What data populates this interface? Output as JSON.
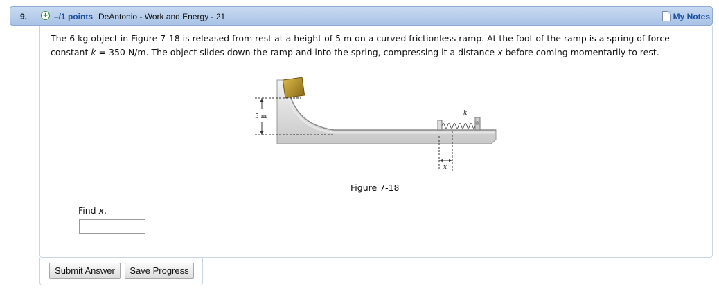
{
  "question": {
    "number": "9.",
    "points": "–/1 points",
    "title": "DeAntonio - Work and Energy - 21",
    "my_notes": "My Notes"
  },
  "problem": {
    "text_1": "The 6 kg object in Figure 7-18 is released from rest at a height of 5 m on a curved frictionless ramp. At the foot of the ramp is a spring of force constant ",
    "k_var": "k",
    "text_2": " = 350 N/m. The object slides down the ramp and into the spring, compressing it a distance ",
    "x_var": "x",
    "text_3": " before coming momentarily to rest."
  },
  "figure": {
    "height_label": "5 m",
    "spring_label": "k",
    "compression_label": "x",
    "caption": "Figure 7-18"
  },
  "answer": {
    "prompt": "Find ",
    "var": "x",
    "prompt_end": ".",
    "value": ""
  },
  "buttons": {
    "submit": "Submit Answer",
    "save": "Save Progress"
  },
  "colors": {
    "header_bg": "#b6cde9",
    "link_blue": "#1b4fa3",
    "plus_green": "#2e8b2e"
  }
}
